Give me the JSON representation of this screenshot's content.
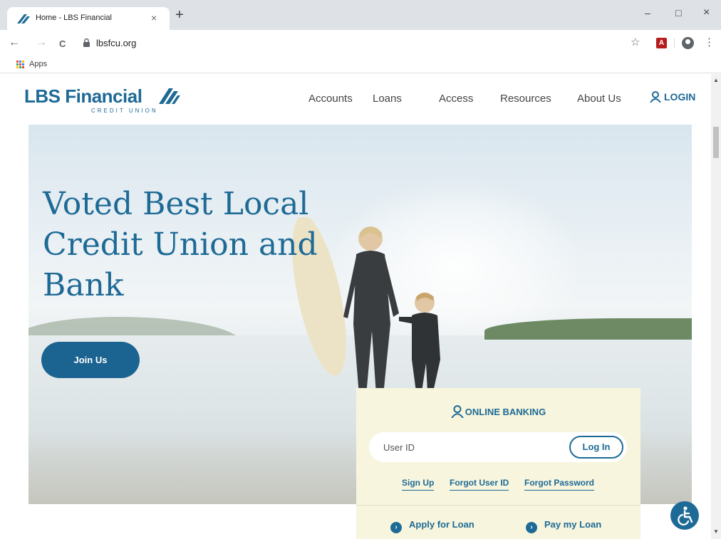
{
  "browser": {
    "tab_title": "Home - LBS Financial",
    "tab_close": "×",
    "new_tab": "+",
    "url": "lbsfcu.org",
    "bookmarks_apps": "Apps",
    "minimize": "–",
    "maximize": "□",
    "close": "×",
    "back": "←",
    "forward": "→",
    "reload": "C",
    "star": "☆",
    "menu": "⋮"
  },
  "site": {
    "logo_text": "LBS Financial",
    "logo_subtext": "CREDIT UNION",
    "brand_color": "#1e6a96",
    "nav": [
      "Accounts",
      "Loans",
      "Access",
      "Resources",
      "About Us"
    ],
    "login_label": "LOGIN"
  },
  "hero": {
    "headline": "Voted Best Local Credit Union and Bank",
    "join_label": "Join Us"
  },
  "online_banking": {
    "title": "ONLINE BANKING",
    "user_id_placeholder": "User ID",
    "login_button": "Log In",
    "links": [
      "Sign Up",
      "Forgot User ID",
      "Forgot Password"
    ],
    "actions": [
      "Apply for Loan",
      "Pay my Loan"
    ]
  }
}
